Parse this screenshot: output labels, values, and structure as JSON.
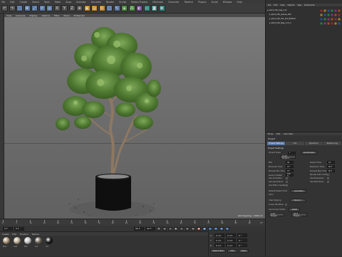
{
  "app": {
    "menu": [
      "File",
      "Edit",
      "Create",
      "Select",
      "Tools",
      "Mesh",
      "Snap",
      "Animate",
      "Simulate",
      "Render",
      "Sculpt",
      "Motion Tracker",
      "MoGraph",
      "Character",
      "Pipeline",
      "Plugins",
      "Script",
      "Window",
      "Help"
    ],
    "toolbar_icons": [
      "undo-icon",
      "redo-icon",
      "selection-icon",
      "move-icon",
      "scale-icon",
      "rotate-icon",
      "recent-tool-icon",
      "axis-x-icon",
      "axis-y-icon",
      "axis-z-icon",
      "coordinate-system-icon",
      "render-view-icon",
      "render-picture-viewer-icon",
      "render-settings-icon",
      "cube-icon",
      "pen-icon",
      "subdivision-icon",
      "array-icon",
      "deformer-icon",
      "floor-icon",
      "camera-icon",
      "light-icon"
    ]
  },
  "viewport": {
    "menu": [
      "View",
      "Cameras",
      "Display",
      "Options",
      "Filter",
      "Panel",
      "ProRender"
    ],
    "grid_note": "Grid Spacing : 1000 cm"
  },
  "timeline": {
    "ticks": [
      "0",
      "5",
      "10",
      "15",
      "20",
      "25",
      "30",
      "35",
      "40",
      "45",
      "50",
      "55",
      "60",
      "65",
      "70",
      "75",
      "80",
      "85",
      "90"
    ],
    "end_label": "0 F"
  },
  "transport": {
    "start": "0 F",
    "current": "0 F",
    "end": "90 F",
    "end2": "90 F",
    "buttons": [
      "first-frame-icon",
      "prev-key-icon",
      "prev-frame-icon",
      "play-icon",
      "next-frame-icon",
      "next-key-icon",
      "last-frame-icon"
    ]
  },
  "materials": {
    "menu": [
      "Create",
      "Edit",
      "Function",
      "Texture"
    ],
    "items": [
      {
        "name": "Bark",
        "color": "#a68f72"
      },
      {
        "name": "Leaf",
        "color": "#b7ad94"
      },
      {
        "name": "Mat",
        "color": "#c4c4c4"
      },
      {
        "name": "Soil",
        "color": "#6f6659"
      },
      {
        "name": "Pot",
        "color": "#151515"
      }
    ]
  },
  "coordinates": {
    "rows": [
      {
        "axis": "X",
        "pos": "0 cm",
        "size": "0 cm",
        "rot": "0 °"
      },
      {
        "axis": "Y",
        "pos": "0 cm",
        "size": "0 cm",
        "rot": "0 °"
      },
      {
        "axis": "Z",
        "pos": "0 cm",
        "size": "0 cm",
        "rot": "0 °"
      }
    ],
    "mode_left": "Object (Rel)",
    "mode_right": "Size",
    "apply": "Apply"
  },
  "objects": {
    "menu": [
      "File",
      "Edit",
      "View",
      "Objects",
      "Tags",
      "Bookmarks"
    ],
    "rows": [
      {
        "label": "plant_bhk_bag_null",
        "indent": 0
      },
      {
        "label": "plant_bhk_leaves_001",
        "indent": 1
      },
      {
        "label": "plant_bhk_Pot_Soil_Bottom",
        "indent": 1
      },
      {
        "label": "plant_bhk_Bag_root_1",
        "indent": 1
      }
    ]
  },
  "attributes": {
    "menu": [
      "Mode",
      "Edit",
      "User Data"
    ],
    "title": "Project",
    "tabs": [
      "Project Settings",
      "Info",
      "Dynamics",
      "Referencing"
    ],
    "section": "Project Settings",
    "project_scale_label": "Project Scale",
    "project_scale_value": "1",
    "project_scale_unit": "Centimeters",
    "scale_button": "Scale Project...",
    "fields_left": [
      {
        "label": "FPS",
        "value": "30"
      },
      {
        "label": "Minimum Time",
        "value": "0 F"
      },
      {
        "label": "Preview Min Time",
        "value": "0 F"
      },
      {
        "label": "Level of Detail",
        "value": "100 %"
      }
    ],
    "fields_right": [
      {
        "label": "Project Time",
        "value": "0 F"
      },
      {
        "label": "Maximum Time",
        "value": "90 F"
      },
      {
        "label": "Preview Max Time",
        "value": "90 F"
      },
      {
        "label": "Render LOD in Editor",
        "value": ""
      }
    ],
    "checks_left": [
      "Use Animation",
      "Use Generators",
      "Use Motion System"
    ],
    "checks_right": [
      "Use Expression",
      "Use Deformers"
    ],
    "default_color_label": "Default Object Color",
    "default_color_value": "Gray-Blue",
    "color_label": "Color",
    "view_clipping_label": "View Clipping",
    "view_clipping_value": "Medium",
    "linear_workflow": "Linear Workflow",
    "input_color_profile_label": "Input Color Profile",
    "input_color_profile_value": "sRGB",
    "load_preset": "Load Preset...",
    "save_preset": "Save Preset..."
  }
}
